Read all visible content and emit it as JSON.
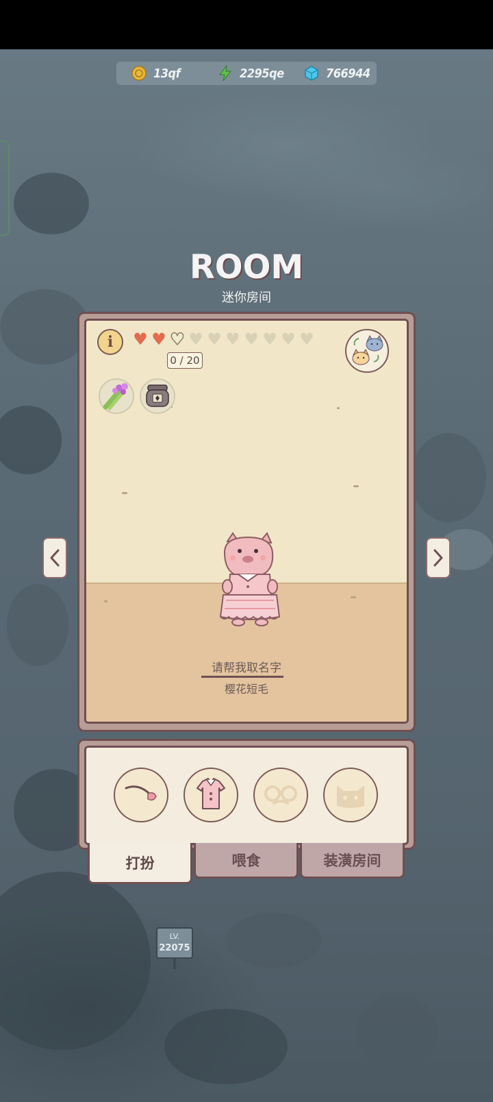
{
  "resources": {
    "coins": "13qf",
    "energy": "2295qe",
    "gems": "766944"
  },
  "room": {
    "title": "ROOM",
    "subtitle": "迷你房间",
    "hearts_filled": 2,
    "hearts_total": 10,
    "heart_progress": "0 / 20",
    "pet_name_prompt": "请帮我取名字",
    "pet_breed": "樱花短毛"
  },
  "actions": [
    {
      "name": "hair-accessory",
      "icon": "feather-clip-icon"
    },
    {
      "name": "outfit",
      "icon": "pink-dress-icon"
    },
    {
      "name": "glasses",
      "icon": "glasses-icon"
    },
    {
      "name": "hat",
      "icon": "cat-hat-icon"
    }
  ],
  "tabs": {
    "dress_up": "打扮",
    "feed": "喂食",
    "decorate": "装潢房间"
  },
  "world": {
    "level_sign_lv": "LV.",
    "level_sign_value": "22075"
  },
  "colors": {
    "heart_full": "#e16c4e",
    "frame_border": "#6e4f52",
    "room_wall": "#f1e7c8",
    "room_floor": "#e4c49e",
    "background": "#5c6c76"
  }
}
